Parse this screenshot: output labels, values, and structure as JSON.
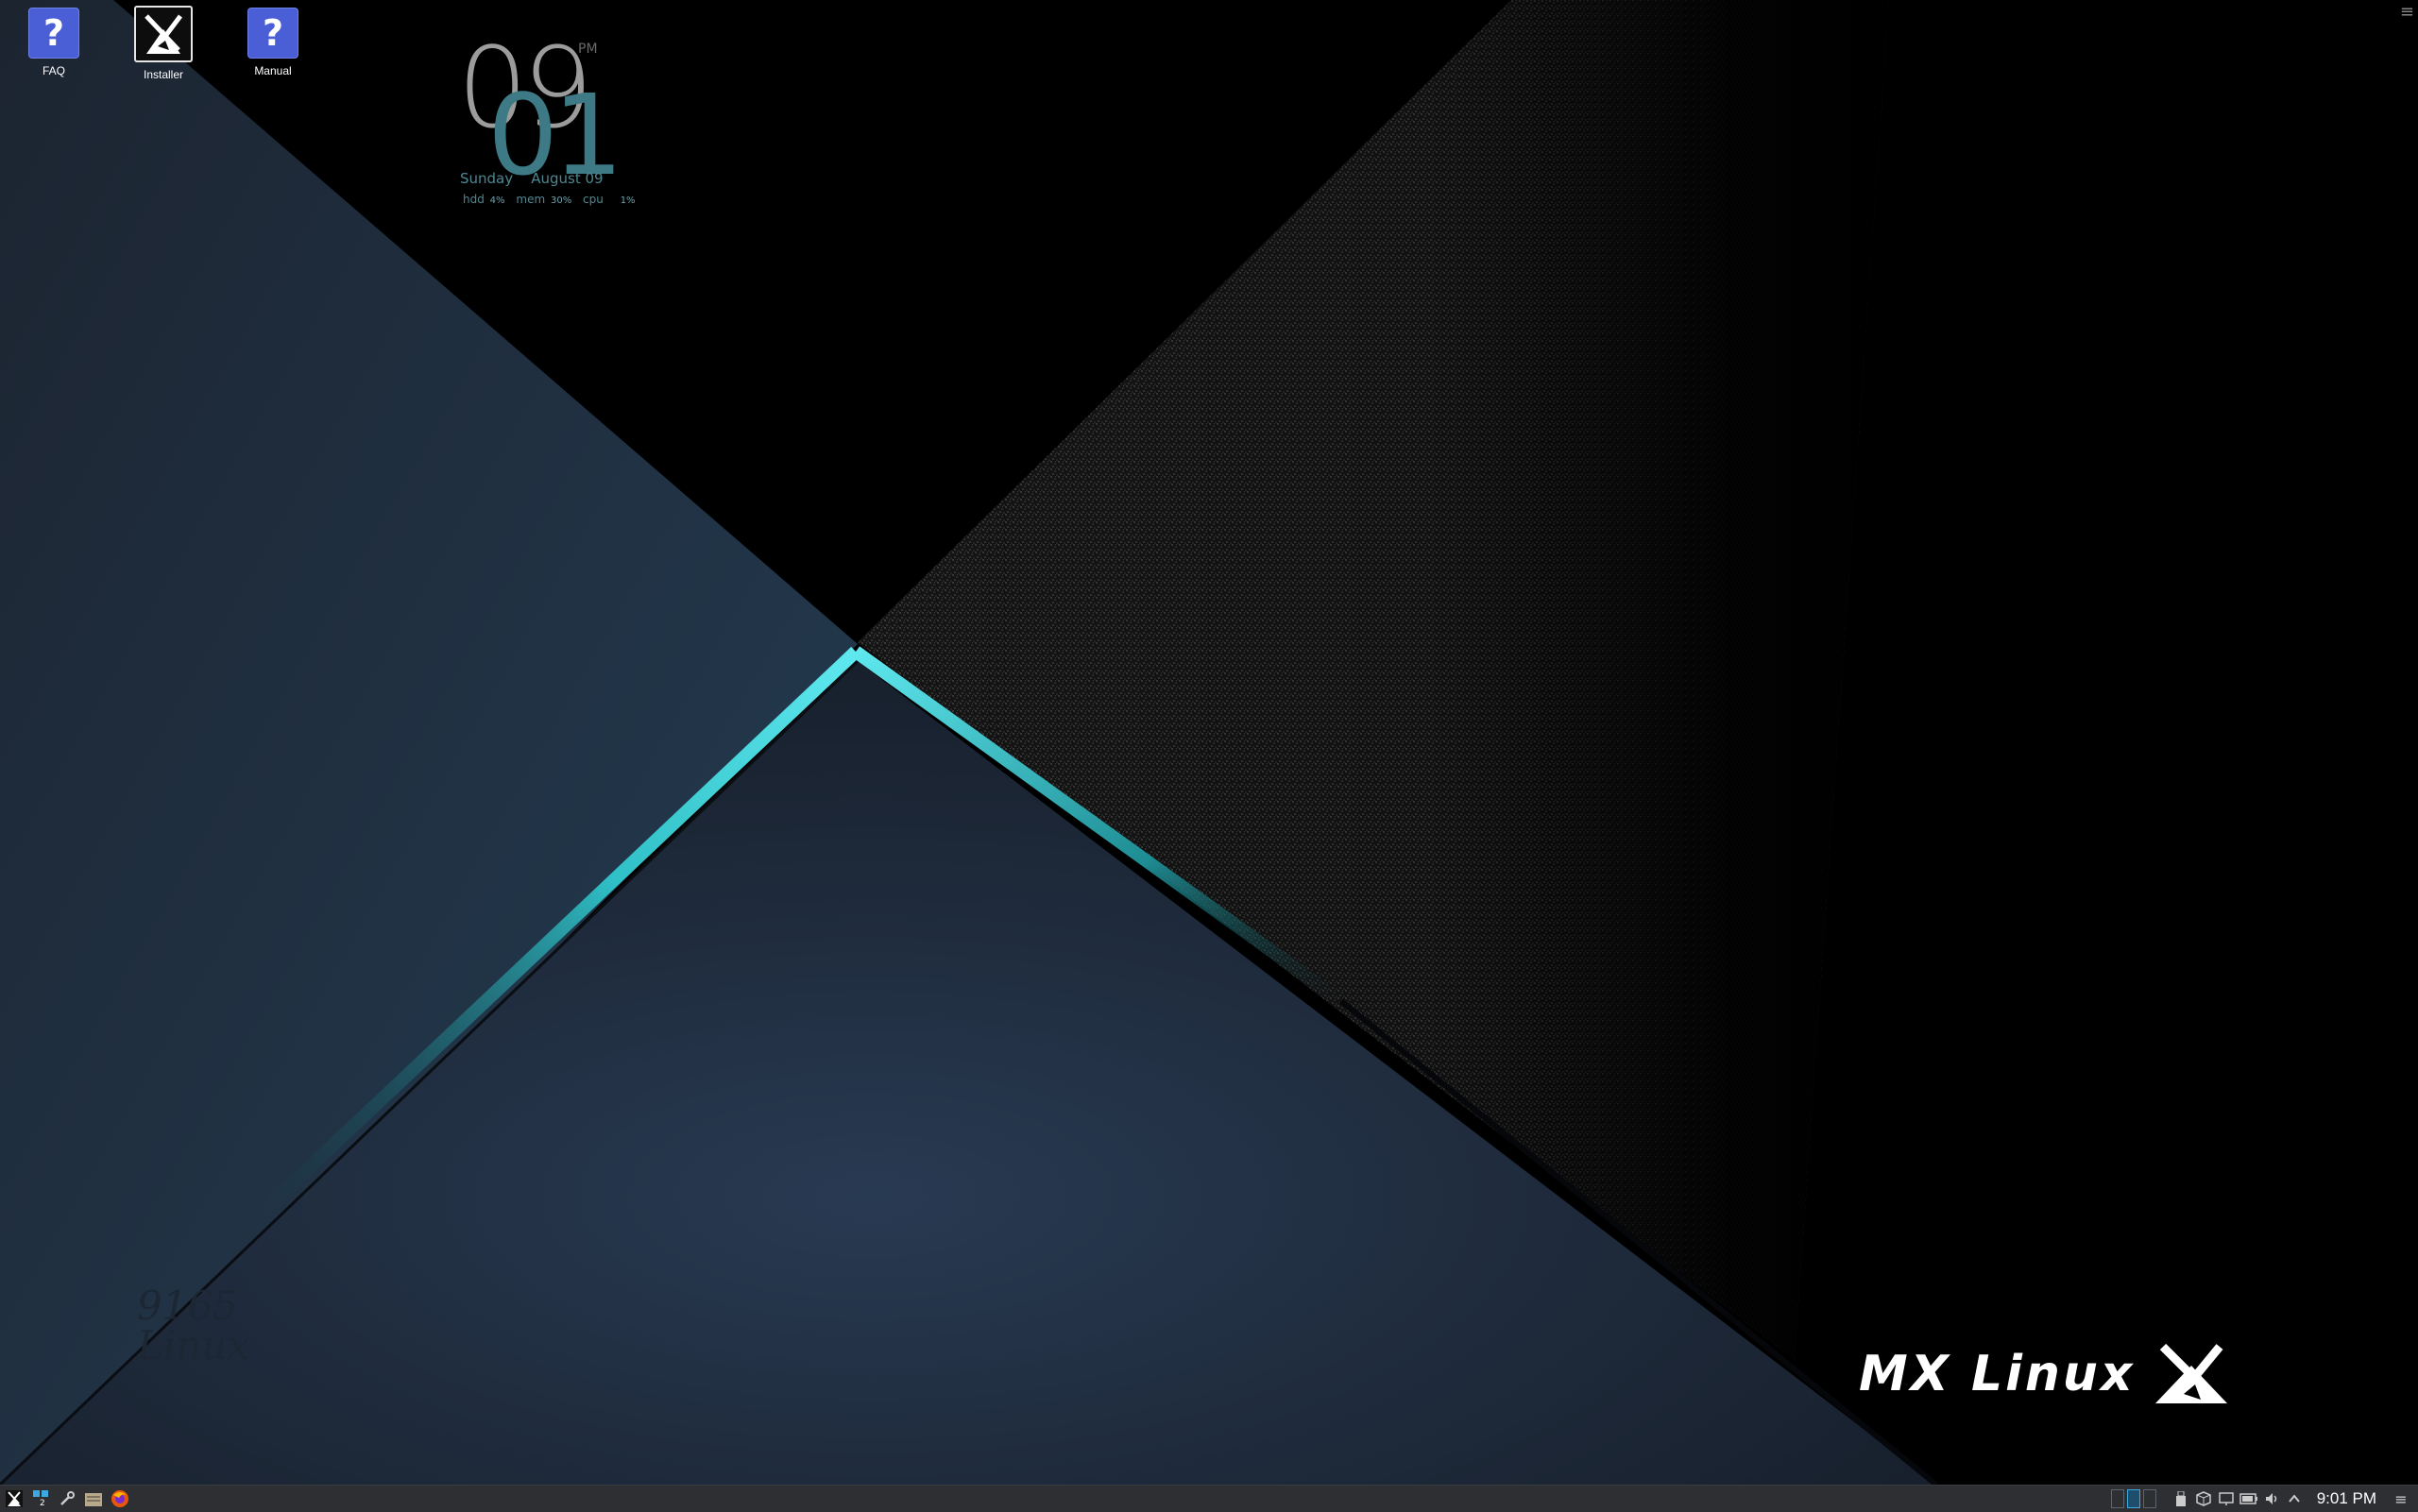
{
  "desktop_icons": [
    {
      "label": "FAQ",
      "icon": "help-icon"
    },
    {
      "label": "Installer",
      "icon": "mx-installer-icon"
    },
    {
      "label": "Manual",
      "icon": "help-icon"
    }
  ],
  "conky": {
    "hour": "09",
    "minute": "01",
    "ampm": "PM",
    "day": "Sunday",
    "date": "August 09",
    "hdd_label": "hdd",
    "hdd_value": "4%",
    "mem_label": "mem",
    "mem_value": "30%",
    "cpu_label": "cpu",
    "cpu_value": "1%"
  },
  "wallpaper_text": {
    "faint_logo_line1": "9165",
    "faint_logo_line2": "Linux",
    "brand": "MX Linux"
  },
  "taskbar": {
    "workspace_count": "2",
    "clock": "9:01 PM",
    "launchers": [
      "mx-menu-icon",
      "workspace-switcher-icon",
      "tools-icon",
      "file-manager-icon",
      "firefox-icon"
    ],
    "tray_icons": [
      "usb-icon",
      "package-icon",
      "display-icon",
      "battery-icon",
      "volume-icon",
      "expand-tray-icon"
    ]
  },
  "colors": {
    "accent_teal": "#3fd6dc",
    "panel": "#2d2f33",
    "help_tile": "#4a5fd6"
  }
}
